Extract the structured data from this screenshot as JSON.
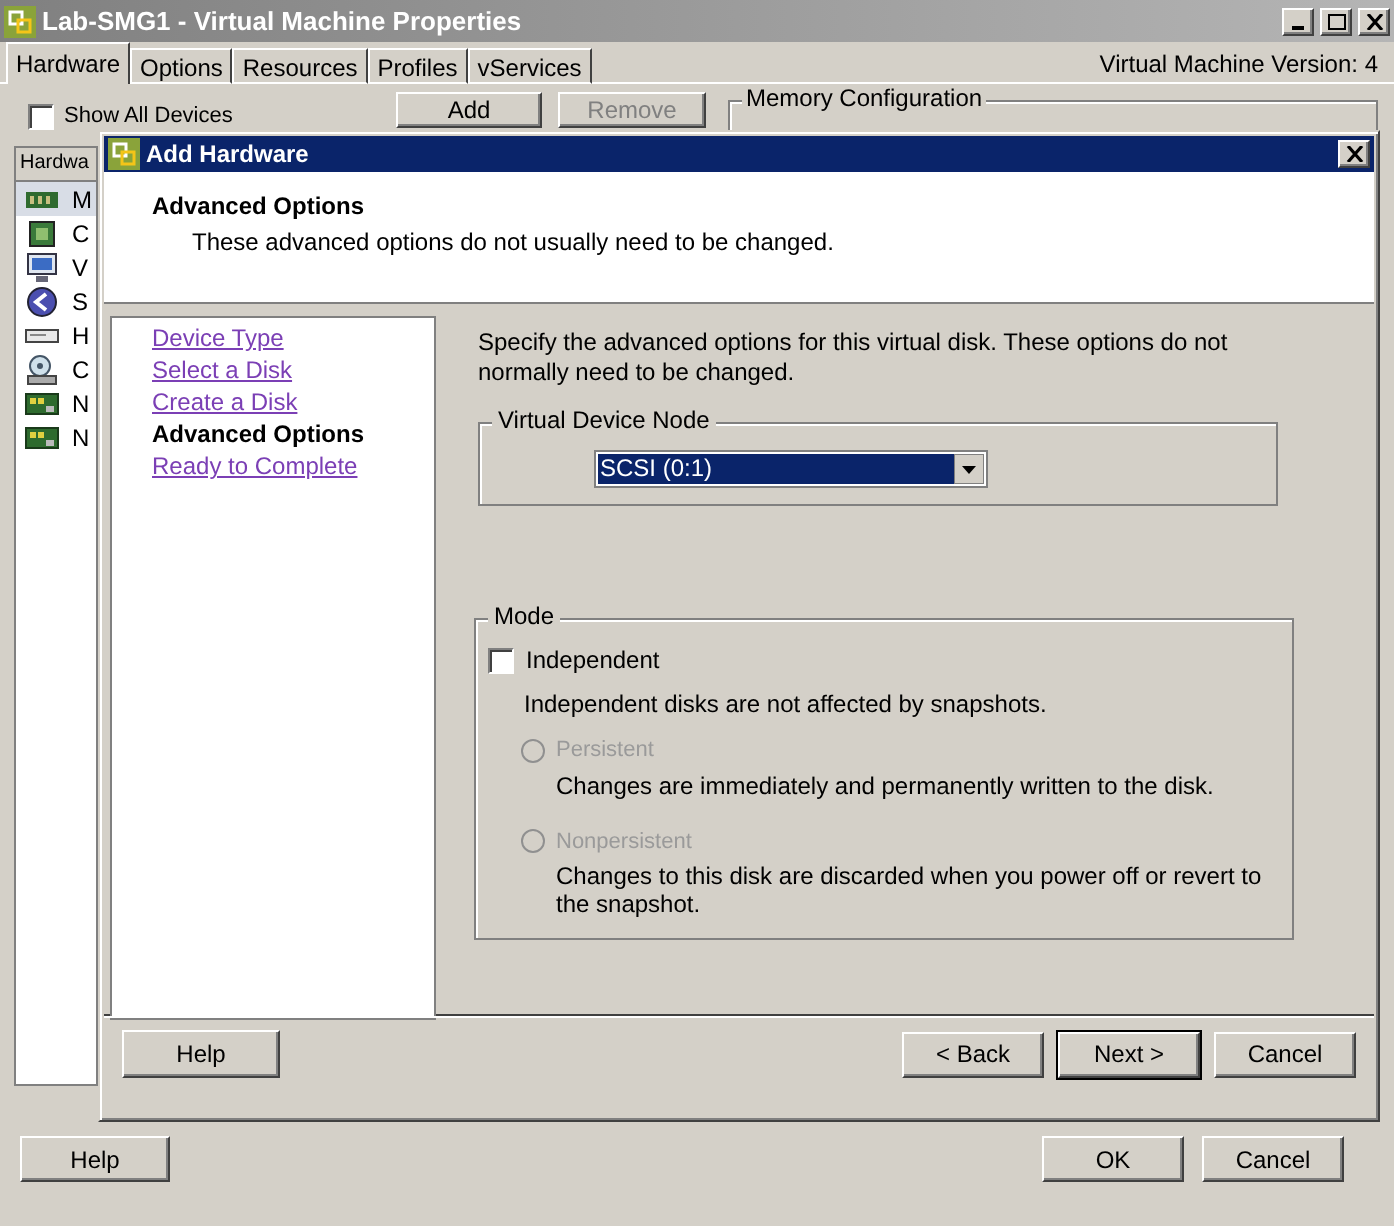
{
  "window": {
    "title": "Lab-SMG1 - Virtual Machine Properties"
  },
  "tabs": [
    {
      "label": "Hardware",
      "selected": true
    },
    {
      "label": "Options",
      "selected": false
    },
    {
      "label": "Resources",
      "selected": false
    },
    {
      "label": "Profiles",
      "selected": false
    },
    {
      "label": "vServices",
      "selected": false
    }
  ],
  "version_label": "Virtual Machine Version: 4",
  "show_all_devices": {
    "label": "Show All Devices",
    "checked": false
  },
  "add_button": {
    "label": "Add",
    "disabled": false
  },
  "remove_button": {
    "label": "Remove",
    "disabled": true
  },
  "memory_group": {
    "title": "Memory Configuration"
  },
  "hardware_list": {
    "header": "Hardwa",
    "items": [
      {
        "kind": "memory",
        "text": "M",
        "selected": true
      },
      {
        "kind": "cpu",
        "text": "C",
        "selected": false
      },
      {
        "kind": "display",
        "text": "V",
        "selected": false
      },
      {
        "kind": "scsi",
        "text": "S",
        "selected": false
      },
      {
        "kind": "disk",
        "text": "H",
        "selected": false
      },
      {
        "kind": "cdrom",
        "text": "C",
        "selected": false
      },
      {
        "kind": "nic",
        "text": "N",
        "selected": false
      },
      {
        "kind": "nic",
        "text": "N",
        "selected": false
      }
    ]
  },
  "dialog": {
    "title": "Add Hardware",
    "header": {
      "title": "Advanced Options",
      "subtitle": "These advanced options do not usually need to be changed."
    },
    "steps": [
      {
        "label": "Device Type",
        "selected": false
      },
      {
        "label": "Select a Disk",
        "selected": false
      },
      {
        "label": "Create a Disk",
        "selected": false
      },
      {
        "label": "Advanced Options",
        "selected": true
      },
      {
        "label": "Ready to Complete",
        "selected": false
      }
    ],
    "description": "Specify the advanced options for this virtual disk. These options do not normally need to be changed.",
    "device_node": {
      "title": "Virtual Device Node",
      "value": "SCSI (0:1)"
    },
    "mode": {
      "title": "Mode",
      "independent": {
        "label": "Independent",
        "checked": false
      },
      "note": "Independent disks are not affected by snapshots.",
      "options": [
        {
          "label": "Persistent",
          "description": "Changes are immediately and permanently written to the disk.",
          "selected": false,
          "disabled": true
        },
        {
          "label": "Nonpersistent",
          "description": "Changes to this disk are discarded when you power off or revert to the snapshot.",
          "selected": false,
          "disabled": true
        }
      ]
    },
    "help_button": "Help",
    "buttons": [
      {
        "label": "< Back",
        "default": false
      },
      {
        "label": "Next >",
        "default": true
      },
      {
        "label": "Cancel",
        "default": false
      }
    ]
  },
  "footer": {
    "help_button": "Help",
    "buttons": [
      "OK",
      "Cancel"
    ]
  }
}
